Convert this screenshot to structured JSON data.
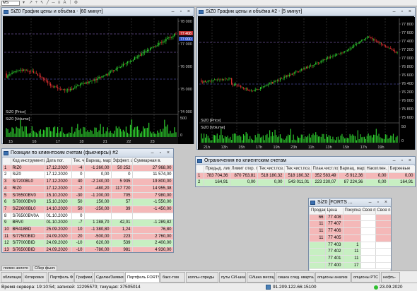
{
  "toolbar": {
    "combo_value": "MS"
  },
  "chart1": {
    "title": "SiZ0 График цены и объёма - [60 минут]",
    "price_labels": [
      "78 000",
      "77 000",
      "76 000",
      "75 000",
      "74 000"
    ],
    "right_labels": [
      "77 408",
      "77 000"
    ],
    "series_price": "SiZ0 [Price]",
    "series_volume": "SiZ0 [Volume]",
    "vol_labels": [
      "500",
      "0"
    ],
    "dates": [
      "15",
      "16",
      "17",
      "18",
      "21",
      "22",
      "23"
    ]
  },
  "chart2": {
    "title": "SiZ0 График цены и объёма #2 - [5 минут]",
    "price_labels": [
      "77 800",
      "77 600",
      "77 400",
      "77 200",
      "77 000",
      "76 800",
      "76 600",
      "76 400",
      "76 200",
      "76 000",
      "75 800",
      "75 600"
    ],
    "series_price": "SiZ0 [Price]",
    "series_volume": "SiZ0 [Volume]",
    "vol_labels": [
      "50",
      "0"
    ],
    "dates": [
      "21h",
      "13h",
      "15h",
      "17h",
      "19h",
      "23h",
      "11h",
      "13h",
      "15h",
      "17h",
      "19h"
    ]
  },
  "positions": {
    "title": "Позиции по клиентским счетам (фьючерсы) #2",
    "headers": [
      "",
      "Код инструмента",
      "Дата пог.",
      "Тек. чист.",
      "Вариац. маржа",
      "Эффект. цена",
      "Суммарная в."
    ],
    "rows": [
      {
        "n": "1",
        "code": "RIZ0",
        "date": "17.12.2020",
        "pos": "-4",
        "vm": "-1 260,00",
        "price": "50 252",
        "sum": "27 968,00",
        "style": "red"
      },
      {
        "n": "2",
        "code": "SiZ0",
        "date": "17.12.2020",
        "pos": "0",
        "vm": "0,00",
        "price": "0",
        "sum": "11 574,00",
        "style": "white"
      },
      {
        "n": "3",
        "code": "Si7200BL0",
        "date": "17.12.2020",
        "pos": "40",
        "vm": "-2 240,00",
        "price": "5 935",
        "sum": "19 800,00",
        "style": "red"
      },
      {
        "n": "4",
        "code": "RIZ0",
        "date": "17.12.2020",
        "pos": "-2",
        "vm": "-480,20",
        "price": "117 720",
        "sum": "14 955,38",
        "style": "red"
      },
      {
        "n": "5",
        "code": "Si76500BV0",
        "date": "15.10.2020",
        "pos": "-30",
        "vm": "-1 200,00",
        "price": "705",
        "sum": "7 980,00",
        "style": "red"
      },
      {
        "n": "6",
        "code": "Si78000BV0",
        "date": "15.10.2020",
        "pos": "50",
        "vm": "150,00",
        "price": "57",
        "sum": "-1 550,00",
        "style": "green"
      },
      {
        "n": "7",
        "code": "SiZ2600BL0",
        "date": "14.10.2020",
        "pos": "50",
        "vm": "-250,00",
        "price": "39",
        "sum": "-1 450,00",
        "style": "red"
      },
      {
        "n": "8",
        "code": "Si76500BV0A",
        "date": "01.10.2020",
        "pos": "0",
        "vm": "",
        "price": "",
        "sum": "",
        "style": "white"
      },
      {
        "n": "9",
        "code": "BRV0",
        "date": "01.10.2020",
        "pos": "-7",
        "vm": "1 288,70",
        "price": "42,01",
        "sum": "-1 289,82",
        "style": "green"
      },
      {
        "n": "10",
        "code": "BR418BD",
        "date": "25.09.2020",
        "pos": "10",
        "vm": "-1 380,80",
        "price": "1,24",
        "sum": "76,80",
        "style": "red"
      },
      {
        "n": "11",
        "code": "Si77500BID",
        "date": "24.09.2020",
        "pos": "20",
        "vm": "-500,00",
        "price": "223",
        "sum": "2 760,00",
        "style": "red"
      },
      {
        "n": "12",
        "code": "Si77000BID",
        "date": "24.09.2020",
        "pos": "-10",
        "vm": "620,00",
        "price": "539",
        "sum": "2 400,00",
        "style": "green"
      },
      {
        "n": "13",
        "code": "Si76500BID",
        "date": "24.09.2020",
        "pos": "-10",
        "vm": "-780,00",
        "price": "981",
        "sum": "4 930,00",
        "style": "red"
      },
      {
        "n": "14",
        "code": "Si73000BUD",
        "date": "24.09.2020",
        "pos": "50",
        "vm": "0,00",
        "price": "1",
        "sum": "-100,00",
        "style": "white"
      }
    ]
  },
  "limits": {
    "title": "Ограничения по клиентским счетам",
    "headers": [
      "",
      "Предыд. лимит",
      "Лимит откр. п",
      "Тек.чист.поз.",
      "Тек.чист.поз. (",
      "План.чист.поз.",
      "Вариац. маржа",
      "Накоплен. д",
      "Биржевые"
    ],
    "rows": [
      {
        "n": "1",
        "c1": "783 704,36",
        "c2": "870 763,81",
        "c3": "518 180,32",
        "c4": "518 180,32",
        "c5": "352 583,49",
        "c6": "-5 912,36",
        "c7": "0,00",
        "c8": "0,00",
        "style": "red"
      },
      {
        "n": "2",
        "c1": "164,91",
        "c2": "0,00",
        "c3": "0,00",
        "c4": "543 011,01",
        "c5": "223 230,07",
        "c6": "87 224,36",
        "c7": "0,00",
        "c8": "164,91",
        "style": "green"
      }
    ]
  },
  "orderbook": {
    "title": "SiZ0 [FORTS ...",
    "headers": [
      "Продаж",
      "Цена",
      "Покупка",
      "Своя п",
      "Своя п"
    ],
    "rows": [
      {
        "sell": "66",
        "price": "77 408",
        "buy": "",
        "style": "red"
      },
      {
        "sell": "11",
        "price": "77 407",
        "buy": "",
        "style": "red"
      },
      {
        "sell": "11",
        "price": "77 406",
        "buy": "",
        "style": "red"
      },
      {
        "sell": "11",
        "price": "77 405",
        "buy": "",
        "style": "red"
      },
      {
        "sell": "",
        "price": "77 403",
        "buy": "1",
        "style": "green"
      },
      {
        "sell": "",
        "price": "77 402",
        "buy": "11",
        "style": "green"
      },
      {
        "sell": "",
        "price": "77 401",
        "buy": "11",
        "style": "green"
      },
      {
        "sell": "",
        "price": "77 400",
        "buy": "17",
        "style": "green"
      }
    ]
  },
  "subtabs": [
    "полюс-золото",
    "Сбер фьюч"
  ],
  "tabs": [
    "облигации",
    "Котировки",
    "Портфель ФР",
    "Графики",
    "Сделки/Заявки",
    "Портфель FORTS",
    "бакс-том",
    "коллы-спреды",
    "путы СИ-шка",
    "СИшка месяц",
    "сишка след. квартал.",
    "опционы анализ",
    "опционы РТС",
    "нефть-"
  ],
  "active_tab": "Портфель FORTS",
  "status": {
    "left": "Время сервера: 19:10:54; записей: 12295570; текущая: 37505014",
    "ip": "91.209.122.66:15100",
    "date": "23.09.2020"
  }
}
